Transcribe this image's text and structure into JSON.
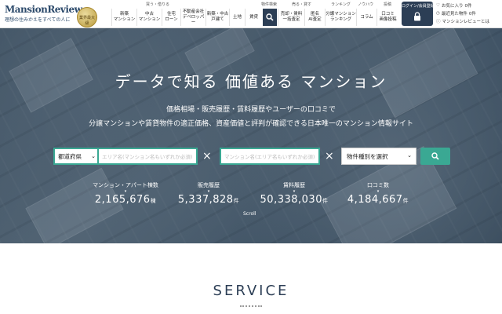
{
  "header": {
    "logo_text": "MansionReview",
    "logo_tagline": "理想の住みかえをすべての人に",
    "badge_text": "業界最大級",
    "nav_groups": [
      {
        "label": "買う・借りる"
      },
      {
        "label": "物件検索"
      },
      {
        "label": "売る・貸す"
      },
      {
        "label": "ランキング"
      },
      {
        "label": "ノウハウ"
      },
      {
        "label": "投稿"
      }
    ],
    "nav_items": [
      {
        "label": "新築\nマンション"
      },
      {
        "label": "中古\nマンション"
      },
      {
        "label": "住宅\nローン"
      },
      {
        "label": "不動産会社\nデベロッパー"
      },
      {
        "label": "新築・中古\n戸建て"
      },
      {
        "label": "土地"
      },
      {
        "label": "賃貸"
      },
      {
        "label": "売却・賃料\n一括査定"
      },
      {
        "label": "匿名\nAI査定"
      },
      {
        "label": "分譲マンション\nランキング"
      },
      {
        "label": "コラム"
      },
      {
        "label": "口コミ\n画像投稿"
      }
    ],
    "login_label": "ログイン/会員登録",
    "side_links": [
      {
        "icon": "heart-icon",
        "label": "お気に入り",
        "count": "0件"
      },
      {
        "icon": "clock-icon",
        "label": "最近見た物件",
        "count": "0件"
      },
      {
        "icon": "question-icon",
        "label": "マンションレビューとは",
        "count": ""
      }
    ]
  },
  "hero": {
    "title": "データで知る 価値ある マンション",
    "subtitle_1": "価格相場・販売履歴・賃料履歴やユーザーの口コミで",
    "subtitle_2": "分譲マンションや賃貸物件の適正価格、資産価値と評判が確認できる日本唯一のマンション情報サイト",
    "prefecture_label": "都道府県",
    "area_placeholder": "エリア名(マンション名もいずれか必須)",
    "name_placeholder": "マンション名(エリア名もいずれか必須)",
    "times_symbol": "×",
    "property_type_label": "物件種別を選択",
    "scroll_label": "Scroll"
  },
  "stats": [
    {
      "label": "マンション・アパート棟数",
      "value": "2,165,676",
      "unit": "棟"
    },
    {
      "label": "販売履歴",
      "value": "5,337,828",
      "unit": "件"
    },
    {
      "label": "賃料履歴",
      "value": "50,338,030",
      "unit": "件"
    },
    {
      "label": "口コミ数",
      "value": "4,184,667",
      "unit": "件"
    }
  ],
  "service": {
    "title": "SERVICE"
  },
  "colors": {
    "accent": "#3aa893",
    "navy": "#2c3e55",
    "gold": "#b99a3c"
  }
}
